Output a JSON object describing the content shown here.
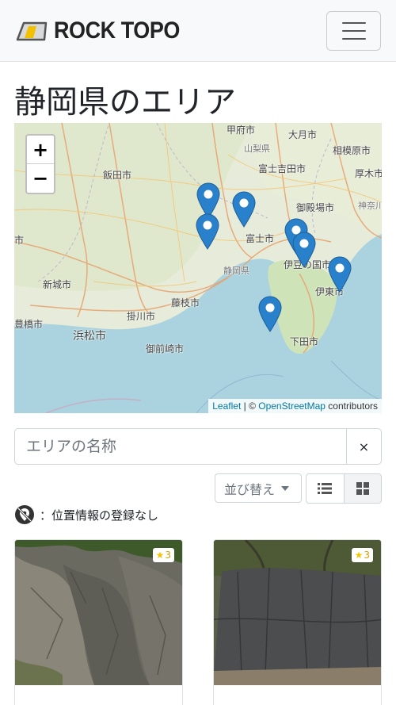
{
  "brand": {
    "name": "ROCK TOPO"
  },
  "page": {
    "title": "静岡県のエリア"
  },
  "map": {
    "zoom_in": "+",
    "zoom_out": "−",
    "places": [
      "甲府市",
      "大月市",
      "山梨県",
      "相模原市",
      "富士吉田市",
      "厚木市",
      "飯田市",
      "御殿場市",
      "神奈川",
      "市",
      "富士市",
      "伊豆の国市",
      "静岡県",
      "伊東市",
      "新城市",
      "藤枝市",
      "掛川市",
      "豊橋市",
      "浜松市",
      "御前崎市",
      "下田市"
    ],
    "attribution": {
      "leaflet": "Leaflet",
      "sep": " | © ",
      "osm": "OpenStreetMap",
      "suffix": " contributors"
    },
    "accent": "#2a81cb"
  },
  "search": {
    "placeholder": "エリアの名称",
    "clear_label": "×"
  },
  "sort": {
    "label": "並び替え"
  },
  "view": {
    "list_icon": "list-icon",
    "grid_icon": "grid-icon"
  },
  "note": {
    "icon": "no-location-icon",
    "text": "：位置情報の登録なし"
  },
  "cards": [
    {
      "rating": "3"
    },
    {
      "rating": "3"
    }
  ]
}
